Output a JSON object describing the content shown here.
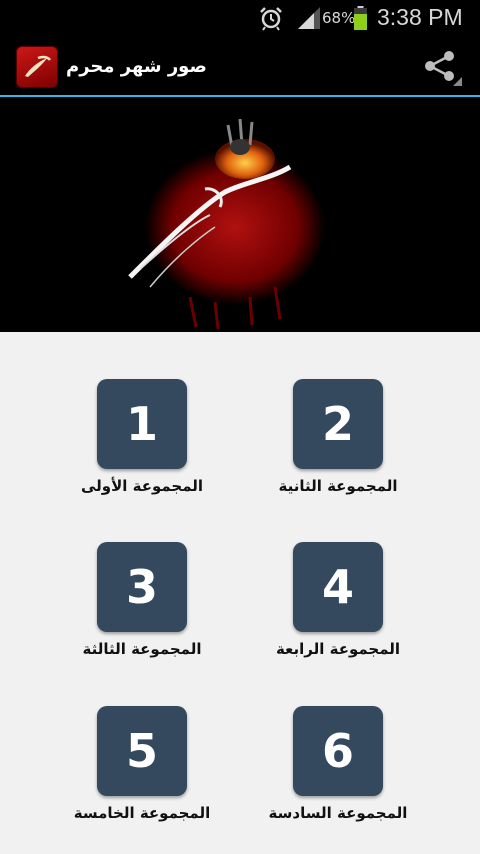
{
  "status_bar": {
    "battery_text": "68%",
    "time": "3:38 PM"
  },
  "action_bar": {
    "title": "صور شهر محرم"
  },
  "groups": [
    {
      "number": "1",
      "label": "المجموعة الأولى"
    },
    {
      "number": "2",
      "label": "المجموعة الثانية"
    },
    {
      "number": "3",
      "label": "المجموعة الثالثة"
    },
    {
      "number": "4",
      "label": "المجموعة الرابعة"
    },
    {
      "number": "5",
      "label": "المجموعة الخامسة"
    },
    {
      "number": "6",
      "label": "المجموعة السادسة"
    }
  ],
  "colors": {
    "tile": "#34495e",
    "accent_line": "#33b5e5",
    "background": "#f1f1f1"
  }
}
